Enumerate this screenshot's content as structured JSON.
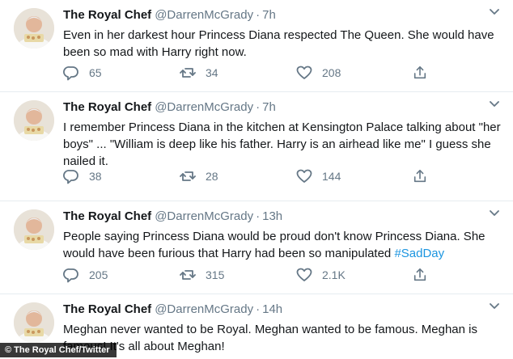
{
  "tweets": [
    {
      "name": "The Royal Chef",
      "handle": "@DarrenMcGrady",
      "separator": "·",
      "time": "7h",
      "text": "Even in her darkest hour Princess Diana respected The Queen. She would have been so mad with Harry right now.",
      "replies": "65",
      "retweets": "34",
      "likes": "208"
    },
    {
      "name": "The Royal Chef",
      "handle": "@DarrenMcGrady",
      "separator": "·",
      "time": "7h",
      "text": "I remember Princess Diana in the kitchen at Kensington Palace talking about \"her boys\" ... \"William is deep like his father. Harry is an airhead like me\" I guess she nailed it.",
      "replies": "38",
      "retweets": "28",
      "likes": "144"
    },
    {
      "name": "The Royal Chef",
      "handle": "@DarrenMcGrady",
      "separator": "·",
      "time": "13h",
      "text": "People saying Princess Diana would be proud don't know Princess Diana. She would have been furious that Harry had been so manipulated",
      "hashtag": "#SadDay",
      "replies": "205",
      "retweets": "315",
      "likes": "2.1K"
    },
    {
      "name": "The Royal Chef",
      "handle": "@DarrenMcGrady",
      "separator": "·",
      "time": "14h",
      "text": "Meghan never wanted to be Royal. Meghan wanted to be famous. Meghan is famous! It's all about Meghan!"
    }
  ],
  "icons": {
    "reply": "reply-icon",
    "retweet": "retweet-icon",
    "like": "heart-icon",
    "share": "share-icon",
    "caret": "chevron-down-icon"
  },
  "colors": {
    "text": "#14171a",
    "muted": "#657786",
    "link": "#1b95e0",
    "divider": "#e6ecf0"
  },
  "credit": "© The Royal Chef/Twitter"
}
